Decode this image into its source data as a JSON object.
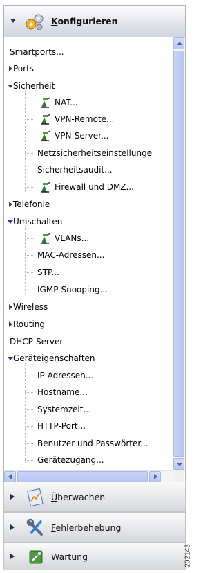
{
  "header": {
    "title_underlined": "K",
    "title_rest": "onfigurieren",
    "arrow": "expand-down"
  },
  "tree": {
    "smartports": "Smartports...",
    "ports": "Ports",
    "sicherheit": {
      "label": "Sicherheit",
      "nat": "NAT...",
      "vpn_remote": "VPN-Remote...",
      "vpn_server": "VPN-Server...",
      "netzsicherheit": "Netzsicherheitseinstellunge",
      "audit": "Sicherheitsaudit...",
      "firewall": "Firewall und DMZ..."
    },
    "telefonie": "Telefonie",
    "umschalten": {
      "label": "Umschalten",
      "vlans": "VLANs...",
      "mac": "MAC-Adressen...",
      "stp": "STP...",
      "igmp": "IGMP-Snooping..."
    },
    "wireless": "Wireless",
    "routing": "Routing",
    "dhcp": "DHCP-Server",
    "geraeteeigenschaften": {
      "label": "Geräteigenschaften",
      "ip": "IP-Adressen...",
      "hostname": "Hostname...",
      "systemzeit": "Systemzeit...",
      "http": "HTTP-Port...",
      "benutzer": "Benutzer und Passwörter...",
      "zugang": "Gerätezugang..."
    }
  },
  "sections": {
    "ueberwachen": {
      "u": "Ü",
      "rest": "berwachen"
    },
    "fehlerbehebung": {
      "u": "F",
      "rest": "ehlerbehebung"
    },
    "wartung": {
      "u": "W",
      "rest": "artung"
    }
  },
  "figure_id": "202143",
  "colors": {
    "accent": "#1f3fa0",
    "scroll": "#b9c7f0",
    "header": "#d2d5de"
  }
}
